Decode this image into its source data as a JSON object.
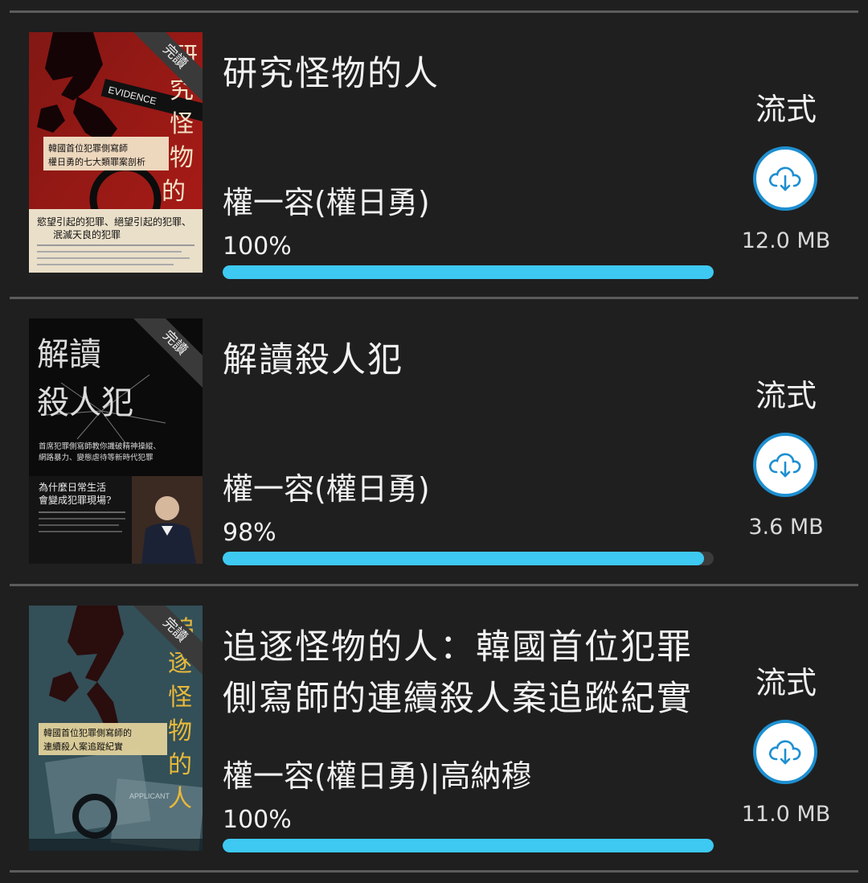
{
  "books": [
    {
      "title": "研究怪物的人",
      "author": "權一容(權日勇)",
      "progress_label": "100%",
      "progress": 1.0,
      "stream_label": "流式",
      "size": "12.0 MB",
      "cover": {
        "ribbon": "完讀",
        "big_title": "研究怪物的人",
        "subtitle_1": "韓國首位犯罪側寫師",
        "subtitle_2": "權日勇的七大類罪案剖析",
        "tagline_1": "慾望引起的犯罪、絕望引起的犯罪、",
        "tagline_2": "泯滅天良的犯罪",
        "evidence": "EVIDENCE",
        "bg_color": "#c8241f"
      }
    },
    {
      "title": "解讀殺人犯",
      "author": "權一容(權日勇)",
      "progress_label": "98%",
      "progress": 0.98,
      "stream_label": "流式",
      "size": "3.6 MB",
      "cover": {
        "ribbon": "完讀",
        "big_title_1": "解讀",
        "big_title_2": "殺人犯",
        "subtitle_1": "首席犯罪側寫師教你識破精神操縱、",
        "subtitle_2": "網路暴力、變態虐待等新時代犯罪",
        "question_1": "為什麼日常生活",
        "question_2": "會變成犯罪現場?",
        "bg_color": "#0b0b0b"
      }
    },
    {
      "title": "追逐怪物的人：韓國首位犯罪側寫師的連續殺人案追蹤紀實",
      "author": "權一容(權日勇)|高納穆",
      "progress_label": "100%",
      "progress": 1.0,
      "stream_label": "流式",
      "size": "11.0 MB",
      "cover": {
        "ribbon": "完讀",
        "big_title": "追逐怪物的人",
        "subtitle_1": "韓國首位犯罪側寫師的",
        "subtitle_2": "連續殺人案追蹤紀實",
        "applicant": "APPLICANT",
        "bg_color": "#40606a"
      }
    }
  ],
  "colors": {
    "background": "#1f1f1f",
    "divider": "#5c5c5c",
    "progress_fill": "#3ec9f2",
    "progress_track": "#3b3b3b",
    "download_ring": "#1e8fd0"
  },
  "icons": {
    "download": "cloud-download-icon"
  }
}
